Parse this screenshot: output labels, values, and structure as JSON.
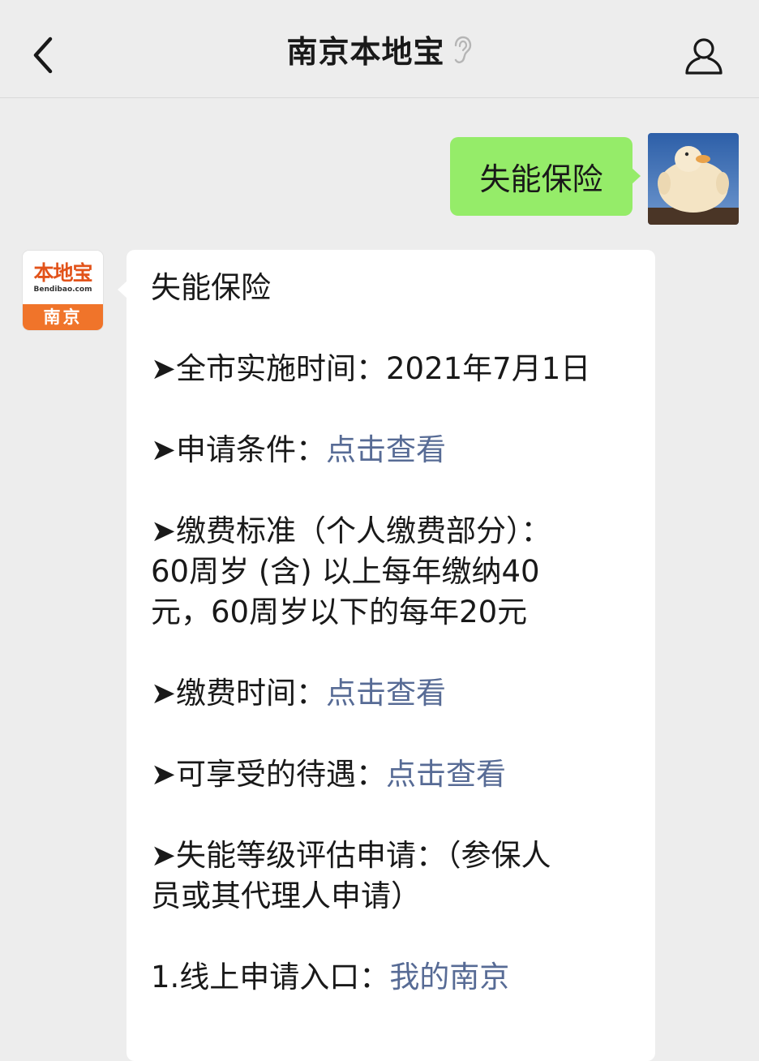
{
  "navbar": {
    "title": "南京本地宝"
  },
  "outgoing": {
    "text": "失能保险"
  },
  "bot": {
    "logo_cn": "本地宝",
    "logo_en": "Bendibao.com",
    "logo_city": "南京"
  },
  "reply": {
    "title": "失能保险",
    "impl_label": "全市实施时间：2021年7月1日",
    "cond_label": "申请条件：",
    "cond_link": "点击查看",
    "fee_line1": "缴费标准（个人缴费部分）：",
    "fee_line2": "60周岁 (含) 以上每年缴纳40",
    "fee_line3": "元，60周岁以下的每年20元",
    "time_label": "缴费时间：",
    "time_link": "点击查看",
    "benefit_label": "可享受的待遇：",
    "benefit_link": "点击查看",
    "assess_line1": "失能等级评估申请：（参保人",
    "assess_line2": "员或其代理人申请）",
    "online_label": "1.线上申请入口：",
    "online_link": "我的南京",
    "arrow": "➤"
  },
  "colors": {
    "background": "#ededed",
    "self_bubble": "#95ec69",
    "link": "#576b95",
    "logo_orange": "#f0742a"
  },
  "icons": [
    "back-icon",
    "ear-icon",
    "profile-icon"
  ]
}
